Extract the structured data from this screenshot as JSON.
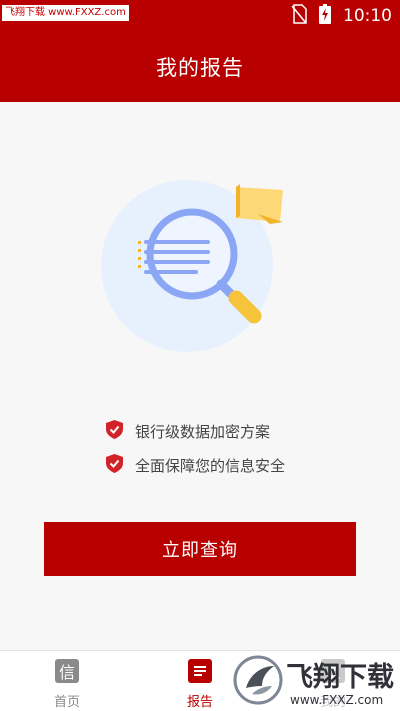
{
  "status_bar": {
    "watermark": "飞翔下载 www.FXXZ.com",
    "time": "10:10",
    "icons": [
      "no-sim-icon",
      "battery-charging-icon"
    ]
  },
  "header": {
    "title": "我的报告"
  },
  "illustration": {
    "icon": "magnifier-report-illustration"
  },
  "features": [
    {
      "icon": "shield-check-icon",
      "text": "银行级数据加密方案"
    },
    {
      "icon": "shield-check-icon",
      "text": "全面保障您的信息安全"
    }
  ],
  "query_button": {
    "label": "立即查询"
  },
  "bottom_nav": {
    "items": [
      {
        "label": "首页",
        "icon_text": "信",
        "icon": "xin-tile-icon",
        "active": false
      },
      {
        "label": "报告",
        "icon": "report-list-icon",
        "active": true
      },
      {
        "label": "我的",
        "icon": "person-icon",
        "active": false
      }
    ]
  },
  "bottom_watermark": {
    "brand": "飞翔下载",
    "url": "www.FXXZ.com"
  },
  "colors": {
    "primary": "#b80000",
    "background": "#f7f7f7",
    "feature_text": "#444444",
    "nav_inactive": "#8a8a8a",
    "illustration_circle": "#e6f1fd",
    "magnifier": "#8aa6f5",
    "flag": "#fdd876"
  }
}
